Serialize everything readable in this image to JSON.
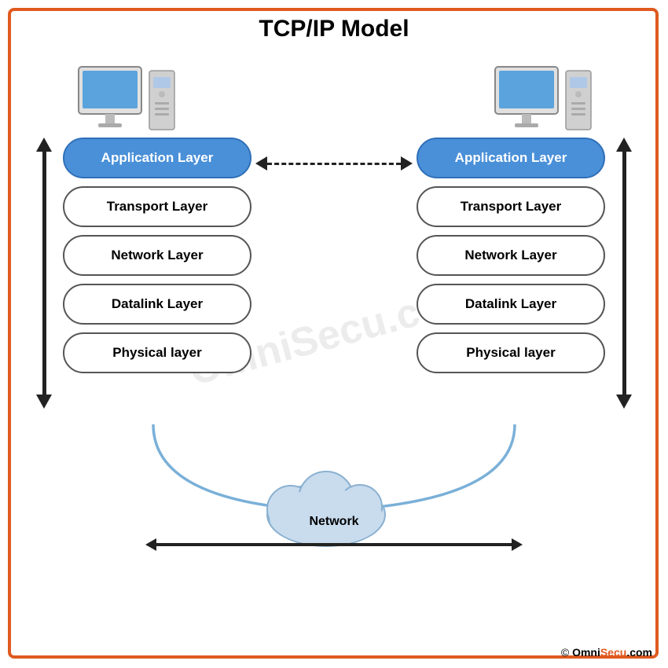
{
  "title": "TCP/IP Model",
  "watermark": "OmniSecu.com",
  "left_layers": [
    {
      "label": "Application Layer",
      "type": "app"
    },
    {
      "label": "Transport Layer",
      "type": "normal"
    },
    {
      "label": "Network Layer",
      "type": "normal"
    },
    {
      "label": "Datalink Layer",
      "type": "normal"
    },
    {
      "label": "Physical layer",
      "type": "normal"
    }
  ],
  "right_layers": [
    {
      "label": "Application Layer",
      "type": "app"
    },
    {
      "label": "Transport Layer",
      "type": "normal"
    },
    {
      "label": "Network Layer",
      "type": "normal"
    },
    {
      "label": "Datalink Layer",
      "type": "normal"
    },
    {
      "label": "Physical layer",
      "type": "normal"
    }
  ],
  "network_label": "Network",
  "footer": {
    "copyright": "©",
    "brand1": "Omni",
    "brand2": "Secu",
    "brand3": ".com"
  }
}
